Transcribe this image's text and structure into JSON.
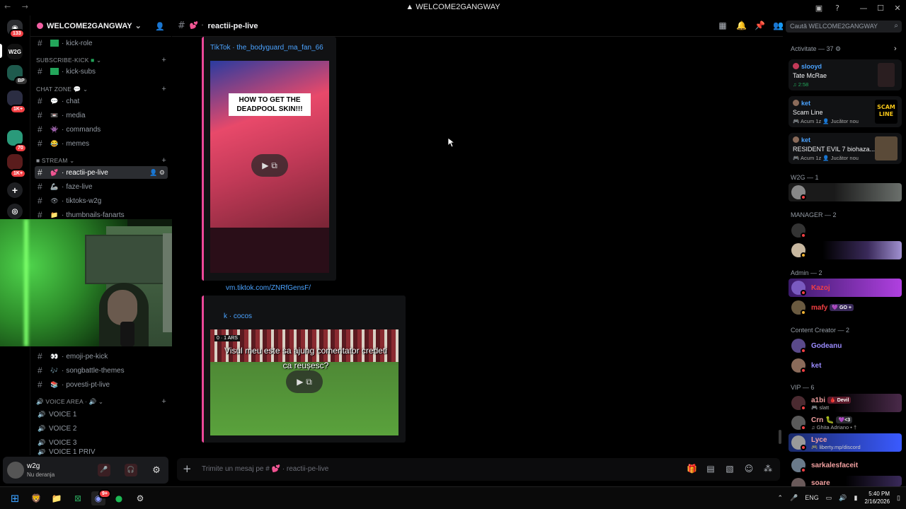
{
  "window": {
    "title": "WELCOME2GANGWAY",
    "nav": "← →"
  },
  "guilds": {
    "dm_badge": "133",
    "items": [
      {
        "label": "W2G"
      },
      {
        "label": "BP"
      },
      {
        "badge": "1K+"
      },
      {
        "badge": "70"
      },
      {
        "badge": "1K+"
      }
    ]
  },
  "server": {
    "name": "WELCOME2GANGWAY"
  },
  "channels": {
    "kick_role": "kick-role",
    "cat_subscribe": "SUBSCRIBE-KICK",
    "kick_subs": "kick-subs",
    "cat_chat": "CHAT ZONE",
    "chat": "chat",
    "media": "media",
    "commands": "commands",
    "memes": "memes",
    "cat_stream": "STREAM",
    "reactii": "reactii-pe-live",
    "faze": "faze-live",
    "tiktoks": "tiktoks-w2g",
    "thumbnails": "thumbnails-fanarts",
    "emoji": "emoji-pe-kick",
    "songbattle": "songbattle-themes",
    "povesti": "povesti-pt-live",
    "cat_voice": "VOICE AREA",
    "voice1": "VOICE 1",
    "voice2": "VOICE 2",
    "voice3": "VOICE 3",
    "voice4": "VOICE 1 PRIV"
  },
  "user": {
    "name": "w2g",
    "status": "Nu deranja"
  },
  "header": {
    "channel": "reactii-pe-live"
  },
  "search": {
    "placeholder": "Caută WELCOME2GANGWAY"
  },
  "messages": {
    "embed1_author": "TikTok · the_bodyguard_ma_fan_66",
    "embed1_caption": "HOW TO GET THE DEADPOOL SKIN!!!",
    "link": "vm.tiktok.com/ZNRfGensF/",
    "embed2_author": "k · cocos",
    "embed2_caption": "Visul meu este sa ajung comentator credeti ca reușesc?",
    "embed2_score": "0 · 1 ARS"
  },
  "composer": {
    "placeholder": "Trimite un mesaj pe # 💕 · reactii-pe-live"
  },
  "members": {
    "activity_header": "Activitate — 37",
    "activities": [
      {
        "user": "slooyd",
        "title": "Tate McRae",
        "meta": "2:58"
      },
      {
        "user": "ket",
        "title": "Scam Line",
        "meta": "Acum 1z",
        "meta2": "Jucător nou"
      },
      {
        "user": "ket",
        "title": "RESIDENT EVIL 7 biohaza...",
        "meta": "Acum 1z",
        "meta2": "Jucător nou"
      }
    ],
    "roles": {
      "w2g": "W2G — 1",
      "manager": "MANAGER — 2",
      "admin": "Admin — 2",
      "creator": "Content Creator — 2",
      "vip": "VIP — 6"
    },
    "people": {
      "kazoj": "Kazoj",
      "mafy": "mafy",
      "mafy_tag": "GO +",
      "godeanu": "Godeanu",
      "ket": "ket",
      "a1bi": "a1bi",
      "a1bi_tag": "Devil",
      "a1bi_sub": "slatt",
      "crn": "Crn",
      "crn_tag": "<3",
      "crn_sub": "Ghita Adriano • †",
      "lyce": "Lyce",
      "lyce_sub": "liberty.mp/discord",
      "sarkales": "sarkalesfaceit",
      "soare": "soare"
    }
  },
  "taskbar": {
    "lang": "ENG",
    "time": "5:40 PM",
    "date": "2/16/2026",
    "discord_badge": "9+"
  },
  "colors": {
    "accent": "#ec4899",
    "link": "#4ba3ff",
    "danger": "#f23f43"
  }
}
